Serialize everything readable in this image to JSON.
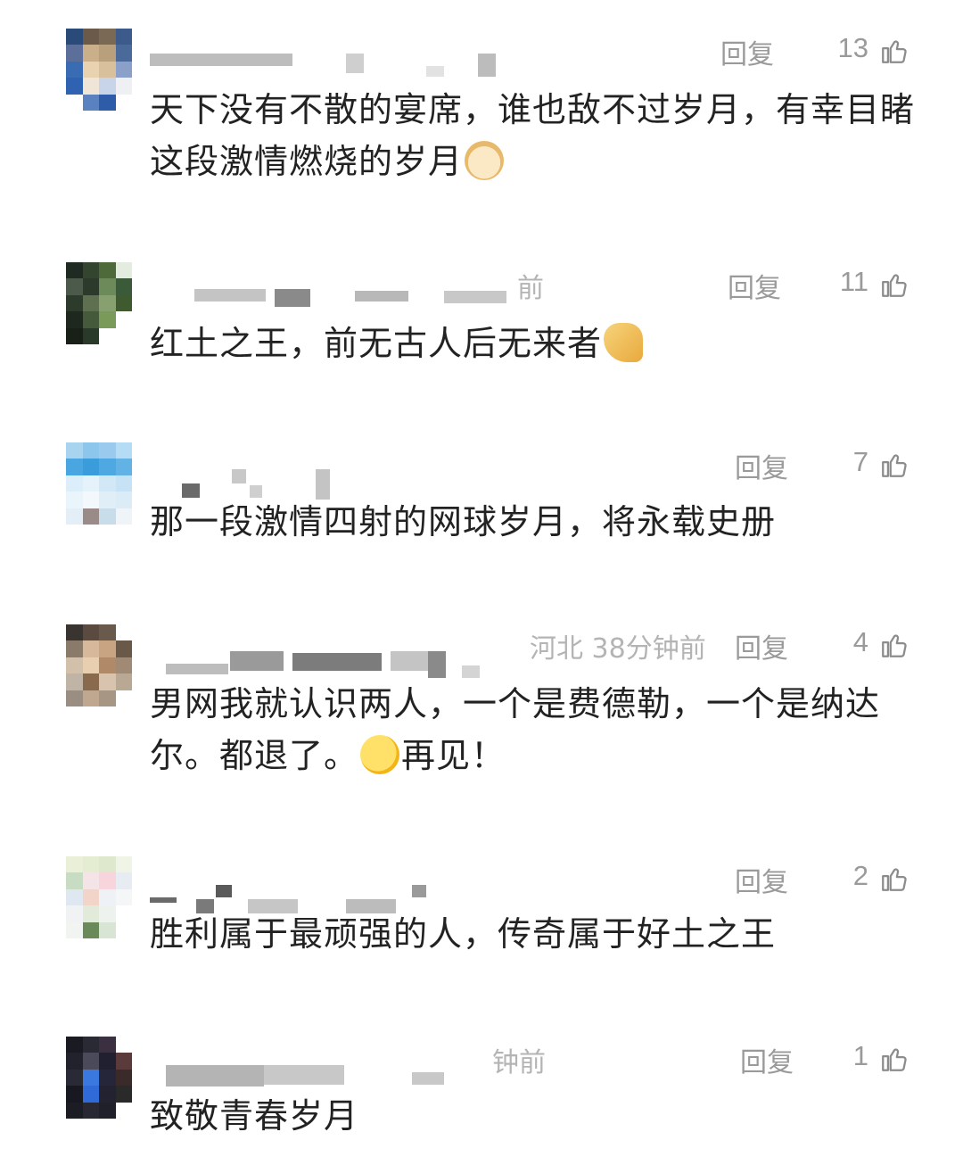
{
  "comments": [
    {
      "time": "",
      "reply_label": "回复",
      "likes": "13",
      "text": "天下没有不散的宴席，谁也敌不过岁月，有幸目睹这段激情燃烧的岁月",
      "emoji": "doge-face-icon"
    },
    {
      "time": "前",
      "reply_label": "回复",
      "likes": "11",
      "text": "红土之王，前无古人后无来者",
      "emoji": "clasped-hands-icon"
    },
    {
      "time": "",
      "reply_label": "回复",
      "likes": "7",
      "text": "那一段激情四射的网球岁月，将永载史册",
      "emoji": ""
    },
    {
      "time": "河北 38分钟前",
      "reply_label": "回复",
      "likes": "4",
      "text_before": "男网我就认识两人，一个是费德勒，一个是纳达尔。都退了。",
      "text_after": "再见！",
      "emoji": "thinking-face-icon"
    },
    {
      "time": "",
      "reply_label": "回复",
      "likes": "2",
      "text": "胜利属于最顽强的人，传奇属于好土之王",
      "emoji": ""
    },
    {
      "time": "钟前",
      "reply_label": "回复",
      "likes": "1",
      "text": "致敬青春岁月",
      "emoji": ""
    }
  ],
  "colors": {
    "text": "#222222",
    "meta": "#9a9a9a",
    "time": "#b4b4b4",
    "background": "#ffffff"
  }
}
